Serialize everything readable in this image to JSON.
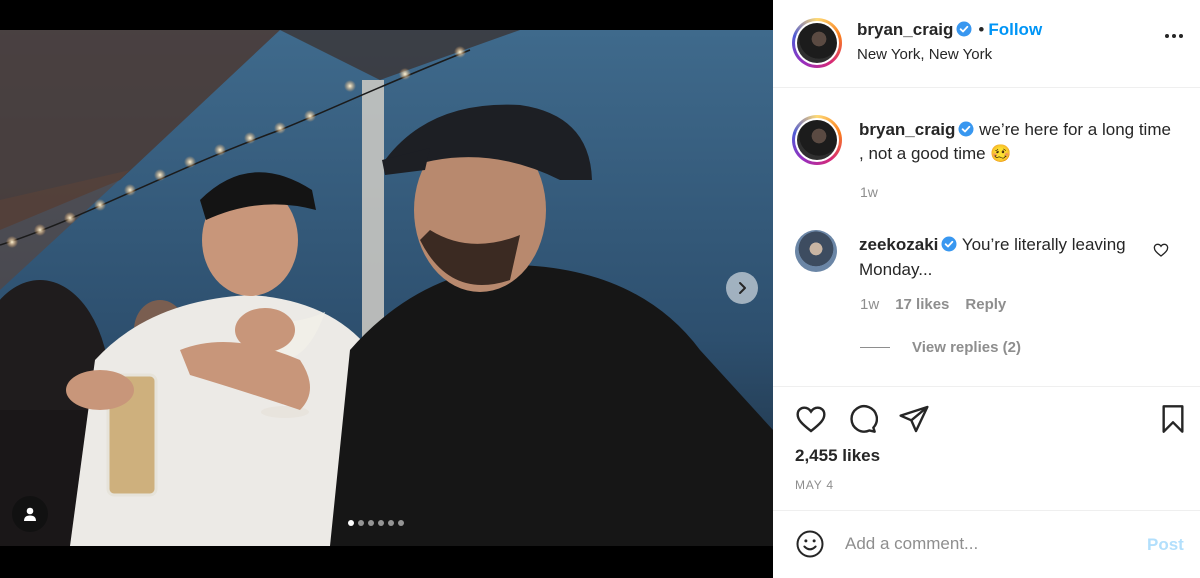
{
  "post": {
    "username": "bryan_craig",
    "follow_label": "Follow",
    "separator": "•",
    "location": "New York, New York",
    "caption": "we’re here for a long time , not a good time 🥴",
    "caption_time": "1w",
    "image_alt": "Two men in caps toasting with drinks under string lights",
    "carousel": {
      "count": 6,
      "active_index": 0
    }
  },
  "comment": {
    "username": "zeekozaki",
    "text": "You’re literally leaving Monday...",
    "time": "1w",
    "likes_label": "17 likes",
    "reply_label": "Reply",
    "view_replies_label": "View replies (2)"
  },
  "actions": {
    "likes_label": "2,455 likes",
    "date_label": "MAY 4"
  },
  "add_comment": {
    "placeholder": "Add a comment...",
    "post_label": "Post"
  },
  "colors": {
    "link_blue": "#0095f6",
    "post_disabled": "#b2dffc",
    "verified_blue": "#3897f0",
    "secondary_text": "#8e8e8e"
  },
  "icons": [
    "chevron-right-icon",
    "user-tag-icon",
    "verified-icon",
    "more-icon",
    "heart-icon",
    "comment-icon",
    "share-icon",
    "bookmark-icon",
    "emoji-icon"
  ]
}
